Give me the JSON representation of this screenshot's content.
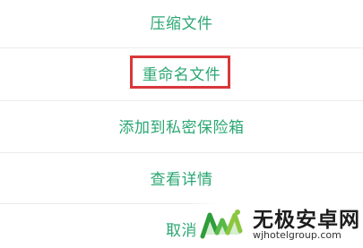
{
  "menu": {
    "items": [
      {
        "label": "压缩文件"
      },
      {
        "label": "重命名文件"
      },
      {
        "label": "添加到私密保险箱"
      },
      {
        "label": "查看详情"
      },
      {
        "label": "取消"
      }
    ]
  },
  "watermark": {
    "title": "无极安卓网",
    "url": "wjhotelgroup.com"
  },
  "colors": {
    "menu_text": "#2aa772",
    "highlight": "#d9373a",
    "divider": "#ececec"
  }
}
